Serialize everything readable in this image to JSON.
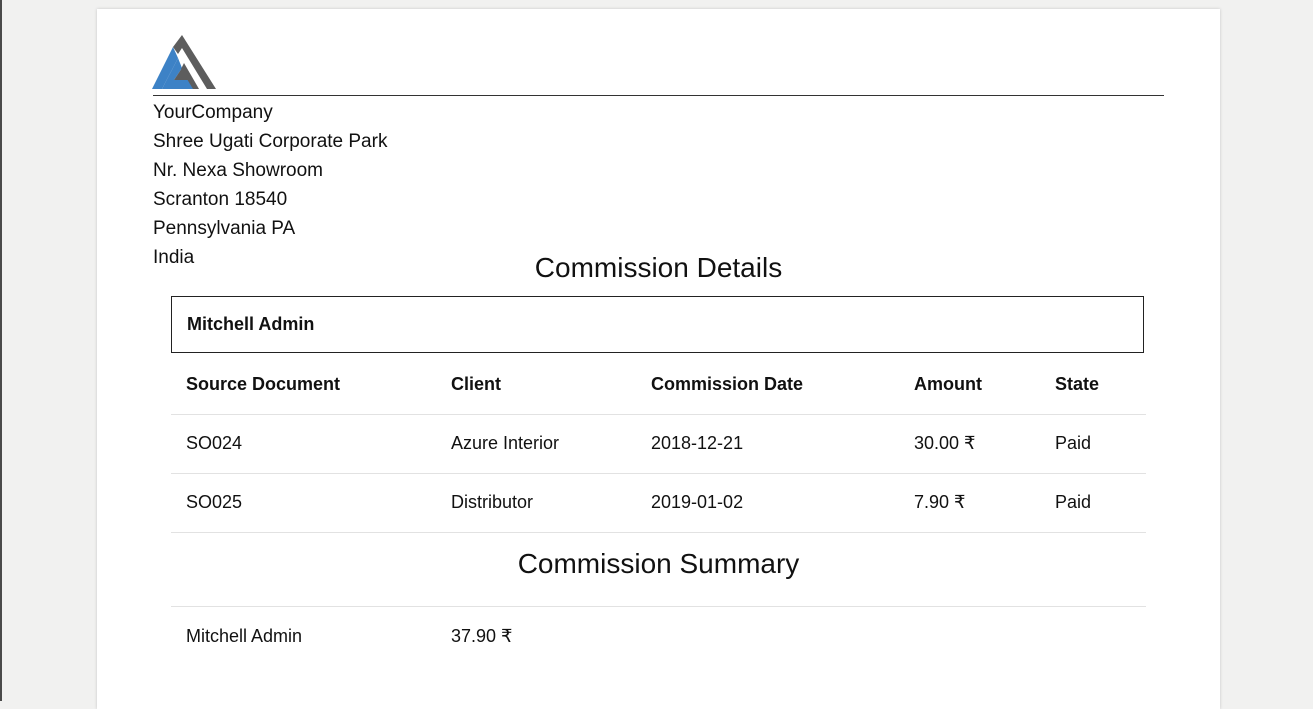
{
  "company": {
    "name": "YourCompany",
    "address_lines": [
      "Shree Ugati Corporate Park",
      "Nr. Nexa Showroom",
      "Scranton 18540",
      "Pennsylvania PA",
      "India"
    ],
    "logo_icon": "triangle-logo-icon",
    "logo_colors": {
      "blue": "#3d82c6",
      "gray": "#5d5d5d"
    }
  },
  "details": {
    "title": "Commission Details",
    "salesperson": "Mitchell Admin",
    "columns": [
      "Source Document",
      "Client",
      "Commission Date",
      "Amount",
      "State"
    ],
    "rows": [
      [
        "SO024",
        "Azure Interior",
        "2018-12-21",
        "30.00 ₹",
        "Paid"
      ],
      [
        "SO025",
        "Distributor",
        "2019-01-02",
        "7.90 ₹",
        "Paid"
      ]
    ]
  },
  "summary": {
    "title": "Commission Summary",
    "rows": [
      [
        "Mitchell Admin",
        "37.90 ₹"
      ]
    ]
  }
}
